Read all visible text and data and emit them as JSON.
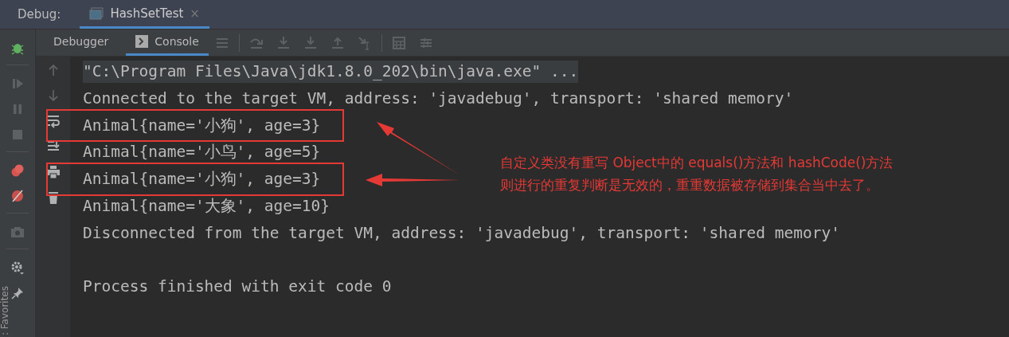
{
  "tool_window": {
    "title": "Debug:",
    "session_tab": {
      "label": "HashSetTest",
      "selected": true,
      "close_glyph": "×"
    }
  },
  "tabs": [
    {
      "label": "Debugger",
      "selected": false
    },
    {
      "label": "Console",
      "selected": true
    }
  ],
  "side_label": ": Favorites",
  "console": [
    {
      "kind": "command",
      "text": "\"C:\\Program Files\\Java\\jdk1.8.0_202\\bin\\java.exe\" ...",
      "boxed": false
    },
    {
      "kind": "output",
      "text": "Connected to the target VM, address: 'javadebug', transport: 'shared memory'",
      "boxed": false
    },
    {
      "kind": "output",
      "text": "Animal{name='小狗', age=3}",
      "boxed": true
    },
    {
      "kind": "output",
      "text": "Animal{name='小鸟', age=5}",
      "boxed": false
    },
    {
      "kind": "output",
      "text": "Animal{name='小狗', age=3}",
      "boxed": true
    },
    {
      "kind": "output",
      "text": "Animal{name='大象', age=10}",
      "boxed": false
    },
    {
      "kind": "output",
      "text": "Disconnected from the target VM, address: 'javadebug', transport: 'shared memory'",
      "boxed": false
    },
    {
      "kind": "blank"
    },
    {
      "kind": "output",
      "text": "Process finished with exit code 0",
      "boxed": false
    }
  ],
  "annotation": {
    "lines": [
      "自定义类没有重写 Object中的 equals()方法和 hashCode()方法",
      "则进行的重复判断是无效的，重重数据被存储到集合当中去了。"
    ]
  }
}
